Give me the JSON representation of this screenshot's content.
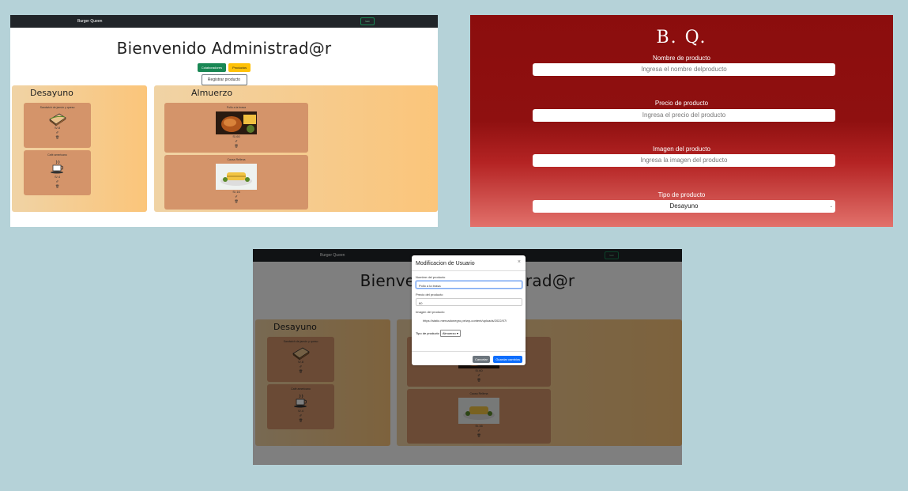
{
  "app": {
    "brand": "Burger Queen",
    "nav_button": "Salir",
    "welcome": "Bienvenido Administrad@r",
    "buttons": {
      "collaborators": "Colaboradores",
      "products": "Productos",
      "register": "Registrar producto"
    },
    "panels": {
      "breakfast": "Desayuno",
      "lunch": "Almuerzo"
    },
    "breakfast_items": [
      {
        "name": "Sandwich de jamón y queso",
        "price": "S/.8",
        "edit_icon": "✐",
        "delete_icon": "🗑"
      },
      {
        "name": "Café americano",
        "price": "S/.4",
        "edit_icon": "✐",
        "delete_icon": "🗑"
      }
    ],
    "lunch_items": [
      {
        "name": "Pollo a la brasa",
        "price": "S/.60",
        "edit_icon": "✐",
        "delete_icon": "🗑"
      },
      {
        "name": "Causa Rellena",
        "price": "S/.16",
        "edit_icon": "✐",
        "delete_icon": "🗑"
      }
    ]
  },
  "form": {
    "logo": "B. Q.",
    "fields": [
      {
        "label": "Nombre de producto",
        "placeholder": "Ingresa el nombre delproducto"
      },
      {
        "label": "Precio de producto",
        "placeholder": "Ingresa el precio del producto"
      },
      {
        "label": "Imagen del producto",
        "placeholder": "Ingresa la imagen del producto"
      }
    ],
    "type_label": "Tipo de producto",
    "type_value": "Desayuno"
  },
  "modal": {
    "title": "Modificacion de Usuario",
    "close": "×",
    "name_label": "Nombre del producto",
    "name_value": "Pollo a la brasa",
    "price_label": "Precio del producto",
    "price_value": "60",
    "image_label": "Imagen del producto",
    "image_value": "https://static.mercadonegro.pe/wp-content/uploads/2022/07/",
    "type_label": "Tipo de producto",
    "type_value": "Almuerzo",
    "cancel": "Cancelar",
    "save": "Guardar cambios"
  },
  "colors": {
    "nav": "#212529",
    "green": "#198754",
    "yellow": "#ffc107",
    "card": "#d4946a",
    "form_red": "#8b0d0d",
    "primary": "#0d6efd",
    "background": "#b5d2d8"
  }
}
